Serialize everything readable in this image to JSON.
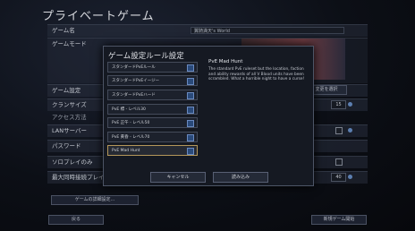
{
  "page": {
    "title": "プライベートゲーム"
  },
  "form": {
    "rows": [
      {
        "label": "ゲーム名"
      },
      {
        "label": "ゲームモード"
      },
      {
        "label": "ゲーム設定"
      },
      {
        "label": "クランサイズ"
      },
      {
        "label": "アクセス方法"
      },
      {
        "label": "LANサーバー"
      },
      {
        "label": "パスワード"
      },
      {
        "label": "ソロプレイのみ"
      },
      {
        "label": "最大同時接続プレイヤ"
      }
    ],
    "game_name_value": "翼騎満天's World",
    "change_rules_button": "変更を選択",
    "clan_size_value": "15",
    "max_players_value": "40",
    "details_button": "ゲームの詳細設定..."
  },
  "bottom": {
    "back": "戻る",
    "start": "新規ゲーム開始"
  },
  "modal": {
    "title": "ゲーム設定ルール設定",
    "options": [
      "スタンダードPvEルール",
      "スタンダードPvEイージー",
      "スタンダードPvEハード",
      "PvE 標 - レベル30",
      "PvE 正午 - レベル50",
      "PvE 黄昏 - レベル70",
      "PvE Mad Hunt"
    ],
    "selected_index": 6,
    "detail_title": "PvE Mad Hunt",
    "detail_text": "The standard PvE ruleset but the location, faction and ability rewards of all V Blood units have been scrambled. What a horrible night to have a curse!",
    "cancel": "キャンセル",
    "load": "読み込み"
  }
}
